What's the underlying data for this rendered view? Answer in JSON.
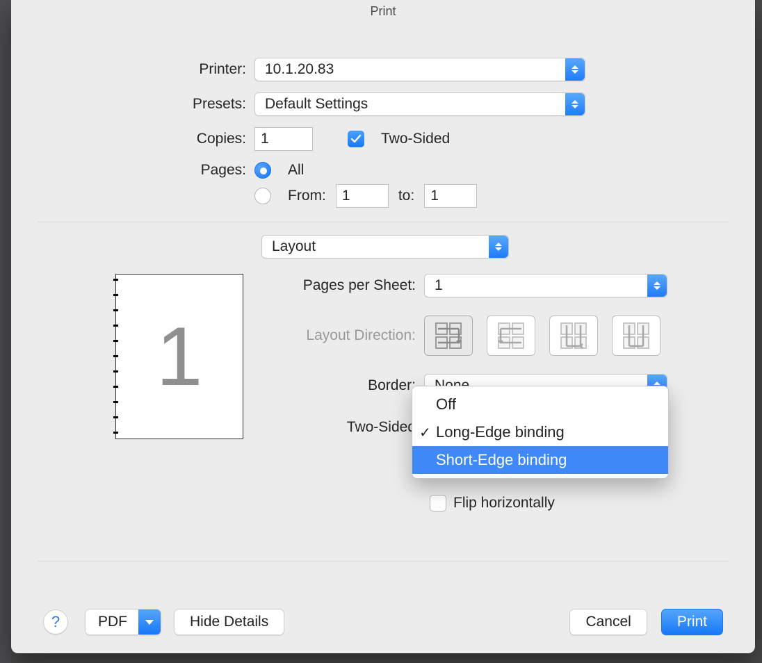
{
  "title": "Print",
  "labels": {
    "printer": "Printer:",
    "presets": "Presets:",
    "copies": "Copies:",
    "two_sided": "Two-Sided",
    "pages": "Pages:",
    "all": "All",
    "from": "From:",
    "to": "to:",
    "pages_per_sheet": "Pages per Sheet:",
    "layout_direction": "Layout Direction:",
    "border": "Border:",
    "two_sided2": "Two-Sided",
    "flip_h": "Flip horizontally"
  },
  "values": {
    "printer": "10.1.20.83",
    "presets": "Default Settings",
    "copies": "1",
    "two_sided_checked": true,
    "pages_mode": "all",
    "from": "1",
    "to": "1",
    "section": "Layout",
    "pages_per_sheet": "1",
    "border": "None",
    "flip_h_checked": false
  },
  "preview_page": "1",
  "two_sided_menu": {
    "options": [
      "Off",
      "Long-Edge binding",
      "Short-Edge binding"
    ],
    "checked_index": 1,
    "highlight_index": 2
  },
  "footer": {
    "help": "?",
    "pdf": "PDF",
    "hide_details": "Hide Details",
    "cancel": "Cancel",
    "print": "Print"
  }
}
